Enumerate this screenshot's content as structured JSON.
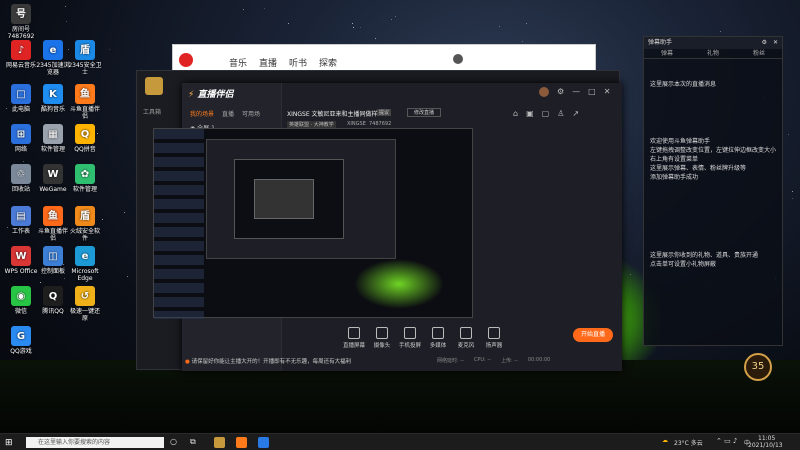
{
  "desktop_icons": [
    {
      "label": "房间号",
      "sub": "7487692",
      "color": "#3a3a3a",
      "glyph": "号"
    },
    {
      "label": "网易云音乐",
      "color": "#e02424",
      "glyph": "♪"
    },
    {
      "label": "2345加速浏览器",
      "color": "#1a73e8",
      "glyph": "e"
    },
    {
      "label": "2345安全卫士",
      "color": "#1b8ae6",
      "glyph": "盾"
    },
    {
      "label": "此电脑",
      "color": "#2a6fdb",
      "glyph": "□"
    },
    {
      "label": "酷狗音乐",
      "color": "#1f8cf0",
      "glyph": "K"
    },
    {
      "label": "斗鱼直播伴侣",
      "color": "#ff7a1a",
      "glyph": "鱼"
    },
    {
      "label": "网络",
      "color": "#2a6fdb",
      "glyph": "⊞"
    },
    {
      "label": "软件管理",
      "color": "#9aa2ad",
      "glyph": "▦"
    },
    {
      "label": "QQ拼音",
      "color": "#ffb400",
      "glyph": "Q"
    },
    {
      "label": "回收站",
      "color": "#7a8899",
      "glyph": "♲"
    },
    {
      "label": "WeGame",
      "color": "#333",
      "glyph": "W"
    },
    {
      "label": "软件管理",
      "color": "#2fbf71",
      "glyph": "✿"
    },
    {
      "label": "工作表",
      "color": "#4b7bd6",
      "glyph": "▤"
    },
    {
      "label": "斗鱼直播伴侣",
      "color": "#ff6a1a",
      "glyph": "鱼"
    },
    {
      "label": "火绒安全软件",
      "color": "#f08a1a",
      "glyph": "盾"
    },
    {
      "label": "WPS Office",
      "color": "#d93636",
      "glyph": "W"
    },
    {
      "label": "控制面板",
      "color": "#3c7fd6",
      "glyph": "◫"
    },
    {
      "label": "Microsoft Edge",
      "color": "#1d9bd7",
      "glyph": "e"
    },
    {
      "label": "微信",
      "color": "#28c445",
      "glyph": "◉"
    },
    {
      "label": "腾讯QQ",
      "color": "#1e1e1e",
      "glyph": "Q"
    },
    {
      "label": "极速一键还原",
      "color": "#f0b01a",
      "glyph": "↺"
    },
    {
      "label": "QQ游戏",
      "color": "#2a8af0",
      "glyph": "G"
    }
  ],
  "browser": {
    "nav": [
      "音乐",
      "直播",
      "听书",
      "探索"
    ]
  },
  "app": {
    "title": "直播伴侣",
    "left_tabs": [
      "我的场景",
      "直播",
      "可用场"
    ],
    "scene_label": "全屏 1",
    "tools_header": "工具箱",
    "tools": [
      "弹幕助手",
      "房管助手",
      "主播任务",
      "视频连麦",
      "录入直播",
      "播放器",
      "房间红包",
      "弹幕墙",
      "歌词助手"
    ],
    "room_title": "XINGSE 文敏尼亚来和主播同做样",
    "room_tag": "提议",
    "room_manage": "修改直播",
    "category": "英雄联盟 · 大神教学",
    "anchor_name": "XINGSE",
    "room_id": "7487692",
    "bottom_bar": [
      "直播屏幕",
      "摄像头",
      "手机投屏",
      "多媒体",
      "麦克风",
      "扬声器"
    ],
    "start_live": "开始直播",
    "notice": "请保留好你能让主播大开的！开播即有不无乐趣，每周还有大福利",
    "stats": [
      "网络延时: --",
      "CPU: --",
      "上传: --",
      "00:00:00"
    ]
  },
  "right_panel": {
    "title": "弹幕助手",
    "tabs": [
      "弹幕",
      "礼物",
      "粉丝"
    ],
    "line1": "这里展示本次的直播消息",
    "welcome": [
      "欢迎使用斗鱼弹幕助手",
      "左键拖拽调整改变位置，左键拉伸边框改变大小",
      "右上角有设置菜单",
      "这里展示弹幕、表情、粉丝牌升级等",
      "添加弹幕助手成功"
    ],
    "gift_note": [
      "这里展示你收到的礼物、道具、贵族开通",
      "点击单可设置小礼物屏蔽"
    ]
  },
  "badge_value": "35",
  "taskbar": {
    "search_placeholder": "在这里输入你要搜索的内容",
    "weather": "23°C 多云",
    "ime": "中",
    "time": "11:05",
    "date": "2021/10/13"
  },
  "colors": {
    "accent": "#ff6a1a",
    "tent": "#7de02c"
  }
}
